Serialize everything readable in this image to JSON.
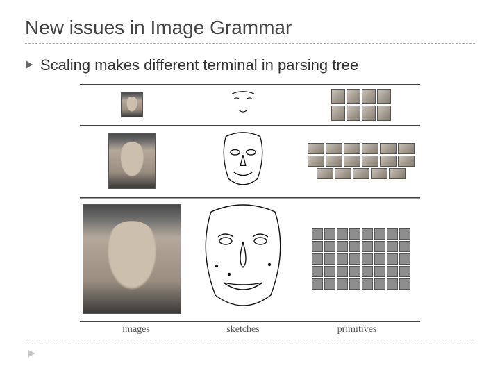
{
  "title": "New issues in Image Grammar",
  "bullet": "Scaling makes different terminal in parsing tree",
  "columns": {
    "images": "images",
    "sketches": "sketches",
    "primitives": "primitives"
  },
  "rows": [
    {
      "scale": "small",
      "primitives_layout": "2x4_faces"
    },
    {
      "scale": "medium",
      "primitives_layout": "3_rows_parts"
    },
    {
      "scale": "large",
      "primitives_layout": "5x8_patches"
    }
  ]
}
